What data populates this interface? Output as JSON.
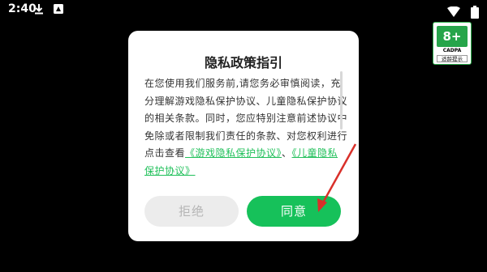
{
  "status_bar": {
    "time": "2:40"
  },
  "age_badge": {
    "rating": "8+",
    "org": "CADPA",
    "tip": "适龄提示"
  },
  "dialog": {
    "title": "隐私政策指引",
    "body_text": "在您使用我们服务前,请您务必审慎阅读，充分理解游戏隐私保护协议、儿童隐私保护协议的相关条款。同时，您应特别注意前述协议中免除或者限制我们责任的条款、对您权利进行点击查看",
    "link_game_privacy": "《游戏隐私保护协议》",
    "separator": "、",
    "link_child_privacy": "《儿童隐私保护协议》",
    "reject_label": "拒绝",
    "agree_label": "同意"
  },
  "colors": {
    "accent_green": "#16c15a",
    "arrow_red": "#d9302a"
  },
  "icons": {
    "status_left": [
      "download-icon",
      "app-notification-icon"
    ],
    "status_right": [
      "wifi-icon",
      "battery-icon"
    ]
  }
}
